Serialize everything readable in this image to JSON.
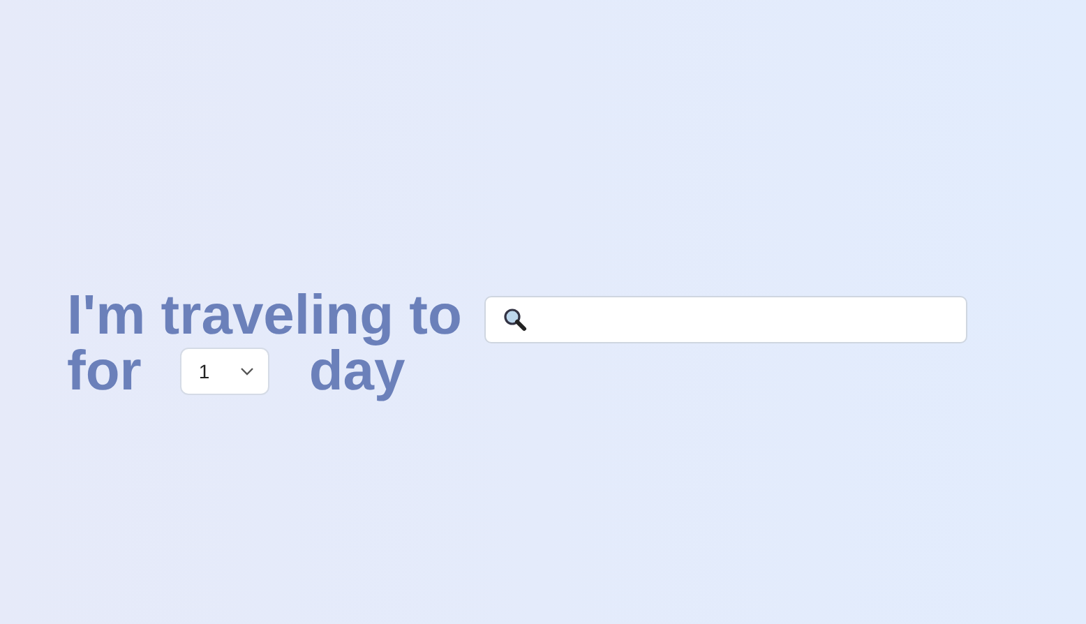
{
  "headline": {
    "line_1": "I'm traveling to",
    "line_2_start": "for",
    "line_2_end": "day"
  },
  "days_select": {
    "value": "1"
  }
}
